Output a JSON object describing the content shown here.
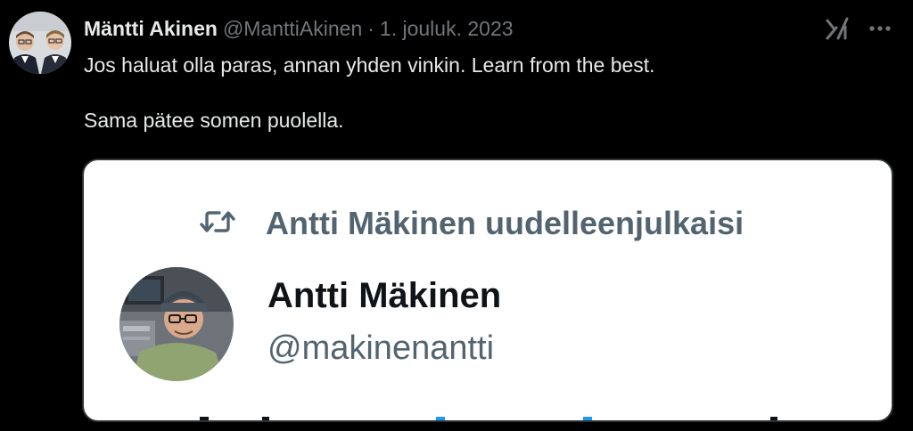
{
  "tweet": {
    "author": {
      "display_name": "Mäntti Akinen",
      "handle": "@ManttiAkinen",
      "separator": "·",
      "date": "1. jouluk. 2023"
    },
    "text_lines": [
      "Jos haluat olla paras, annan yhden vinkin. Learn from the best.",
      "Sama pätee somen puolella."
    ],
    "icons": {
      "grok": "grok-icon",
      "more": "more-icon",
      "repost": "repost-icon"
    }
  },
  "embedded_screenshot": {
    "repost_label": "Antti Mäkinen uudelleenjulkaisi",
    "name": "Antti Mäkinen",
    "handle": "@makinenantti"
  },
  "colors": {
    "background": "#000000",
    "primary_text": "#e7e9ea",
    "secondary_text": "#71767b",
    "card_background": "#ffffff",
    "card_secondary_text": "#536471",
    "card_primary_text": "#0f1419"
  }
}
